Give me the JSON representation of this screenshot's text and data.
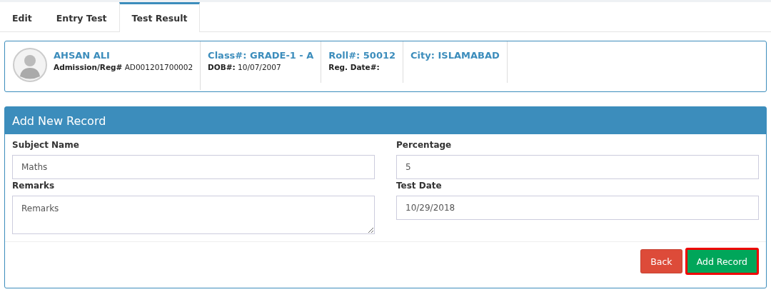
{
  "tabs": [
    {
      "label": "Edit",
      "selected": false
    },
    {
      "label": "Entry Test",
      "selected": false
    },
    {
      "label": "Test Result",
      "selected": true
    }
  ],
  "student": {
    "name": "AHSAN ALI",
    "details": [
      {
        "label": "Admission/Reg#",
        "value": "AD001201700002"
      }
    ],
    "columns": [
      {
        "title": "Class#: GRADE-1 - A",
        "label": "DOB#:",
        "value": "10/07/2007"
      },
      {
        "title": "Roll#: 50012",
        "label": "Reg. Date#:"
      },
      {
        "title": "City: ISLAMABAD"
      }
    ]
  },
  "panel": {
    "title": "Add New Record",
    "fields": [
      {
        "label": "Subject Name",
        "value": "Maths",
        "kind": "input"
      },
      {
        "label": "Percentage",
        "value": "5",
        "kind": "input"
      },
      {
        "label": "Remarks",
        "placeholder": "Remarks",
        "kind": "textarea"
      },
      {
        "label": "Test Date",
        "value": "10/29/2018",
        "kind": "input"
      }
    ],
    "buttons": [
      {
        "label": "Back",
        "kind": "danger",
        "highlighted": false
      },
      {
        "label": "Add Record",
        "kind": "success",
        "highlighted": true
      }
    ]
  }
}
